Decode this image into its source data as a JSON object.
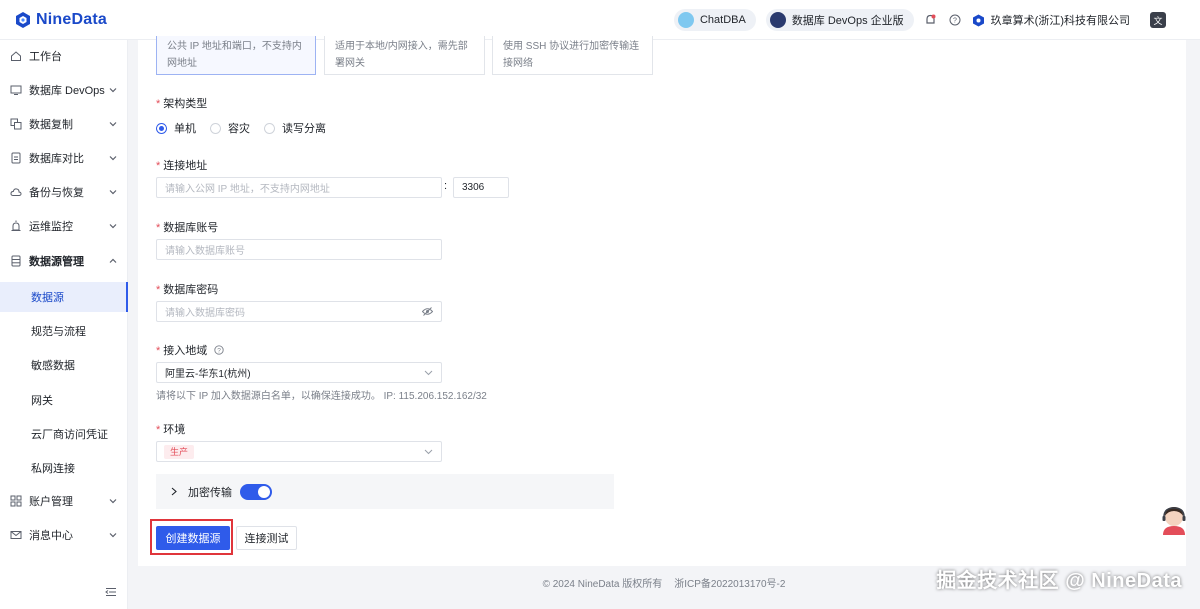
{
  "app": {
    "name": "NineData"
  },
  "topbar": {
    "chatdba": "ChatDBA",
    "devops_pill": "数据库 DevOps 企业版",
    "org": "玖章算术(浙江)科技有限公司"
  },
  "sidebar": {
    "items": [
      {
        "label": "工作台"
      },
      {
        "label": "数据库 DevOps"
      },
      {
        "label": "数据复制"
      },
      {
        "label": "数据库对比"
      },
      {
        "label": "备份与恢复"
      },
      {
        "label": "运维监控"
      },
      {
        "label": "数据源管理"
      }
    ],
    "sub_items": [
      {
        "label": "数据源"
      },
      {
        "label": "规范与流程"
      },
      {
        "label": "敏感数据"
      },
      {
        "label": "网关"
      },
      {
        "label": "云厂商访问凭证"
      },
      {
        "label": "私网连接"
      }
    ],
    "bottom_items": [
      {
        "label": "账户管理"
      },
      {
        "label": "消息中心"
      }
    ]
  },
  "form": {
    "access_options": [
      {
        "line1": "公共 IP 地址和端口，不支持内",
        "line2": "网地址"
      },
      {
        "line1": "适用于本地/内网接入，需先部",
        "line2": "署网关"
      },
      {
        "line1": "使用 SSH 协议进行加密传输连",
        "line2": "接网络"
      }
    ],
    "arch_label": "架构类型",
    "arch_options": [
      "单机",
      "容灾",
      "读写分离"
    ],
    "addr_label": "连接地址",
    "addr_placeholder": "请输入公网 IP 地址，不支持内网地址",
    "port_sep": ":",
    "port_value": "3306",
    "account_label": "数据库账号",
    "account_placeholder": "请输入数据库账号",
    "password_label": "数据库密码",
    "password_placeholder": "请输入数据库密码",
    "region_label": "接入地域",
    "region_value": "阿里云-华东1(杭州)",
    "region_hint": "请将以下 IP 加入数据源白名单，以确保连接成功。 IP: 115.206.152.162/32",
    "env_label": "环境",
    "env_tag": "生产",
    "encrypt_label": "加密传输",
    "encrypt_on": true,
    "create_button": "创建数据源",
    "test_button": "连接测试"
  },
  "footer": {
    "copyright": "© 2024 NineData 版权所有",
    "icp": "浙ICP备2022013170号-2"
  },
  "watermark": "掘金技术社区 @ NineData",
  "colors": {
    "primary": "#2f5bea",
    "brand": "#1a49c9",
    "danger": "#e34d59"
  }
}
